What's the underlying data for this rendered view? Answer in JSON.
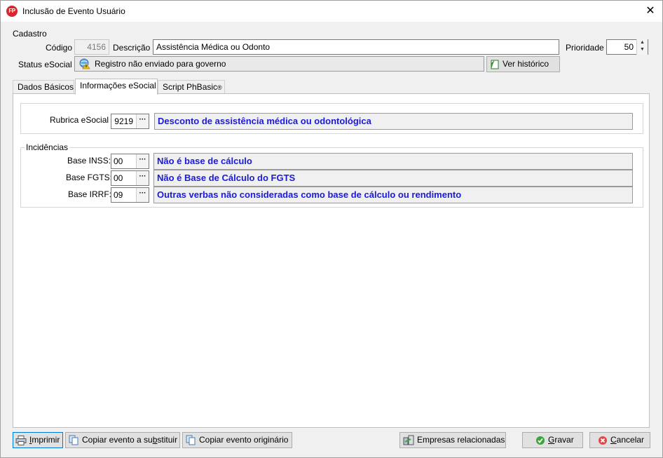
{
  "window": {
    "title": "Inclusão de Evento Usuário",
    "icon_text": "FP",
    "close_glyph": "✕"
  },
  "cadastro": {
    "group_label": "Cadastro",
    "codigo_label": "Código",
    "codigo_value": "4156",
    "descricao_label": "Descrição",
    "descricao_value": "Assistência Médica ou Odonto",
    "prioridade_label": "Prioridade",
    "prioridade_value": "50",
    "status_label": "Status eSocial",
    "status_value": "Registro não enviado para governo",
    "historico_button": "Ver histórico"
  },
  "tabs": [
    {
      "label": "Dados Básicos"
    },
    {
      "label": "Informações eSocial"
    },
    {
      "label": "Script PhBasic",
      "badge": "®"
    }
  ],
  "active_tab": 1,
  "esocial": {
    "rubrica_label": "Rubrica eSocial",
    "rubrica_code": "9219",
    "rubrica_desc": "Desconto de assistência médica ou odontológica",
    "incidencias_label": "Incidências",
    "lookup_glyph": "···",
    "incidencias": [
      {
        "label": "Base INSS:",
        "code": "00",
        "desc": "Não é base de cálculo"
      },
      {
        "label": "Base FGTS:",
        "code": "00",
        "desc": "Não é Base de Cálculo do FGTS"
      },
      {
        "label": "Base IRRF:",
        "code": "09",
        "desc": "Outras verbas não consideradas como base de cálculo ou rendimento"
      }
    ]
  },
  "footer": {
    "imprimir_pre": "",
    "imprimir_u": "I",
    "imprimir_post": "mprimir",
    "copiar_sub_pre": "Copiar evento a su",
    "copiar_sub_u": "b",
    "copiar_sub_post": "stituir",
    "copiar_orig": "Copiar evento originário",
    "empresas": "Empresas relacionadas",
    "gravar_u": "G",
    "gravar_post": "ravar",
    "cancelar_u": "C",
    "cancelar_post": "ancelar"
  },
  "colors": {
    "desc_text": "#1a1adc",
    "cancel_icon": "#e04848",
    "ok_icon": "#3aa63a"
  }
}
